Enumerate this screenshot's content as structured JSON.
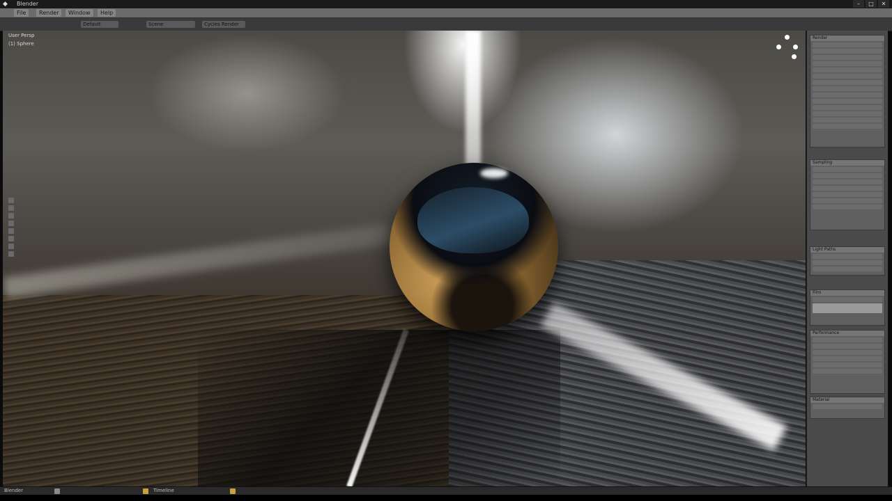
{
  "window": {
    "title": "Blender",
    "controls": [
      "–",
      "□",
      "✕"
    ]
  },
  "menubar": {
    "items": [
      "File",
      "Render",
      "Window",
      "Help"
    ]
  },
  "toolbar": {
    "segments": [
      "Default",
      "Scene",
      "Cycles Render"
    ]
  },
  "viewport": {
    "label_top": "User Persp",
    "label_sub": "(1) Sphere",
    "render_type": "Rendered"
  },
  "properties": {
    "sections": [
      "Render",
      "Sampling",
      "Light Paths",
      "Film",
      "Performance"
    ],
    "material_section": "Material"
  },
  "statusbar": {
    "left_text": "Blender",
    "mid_text": "Timeline",
    "right_text": ""
  }
}
